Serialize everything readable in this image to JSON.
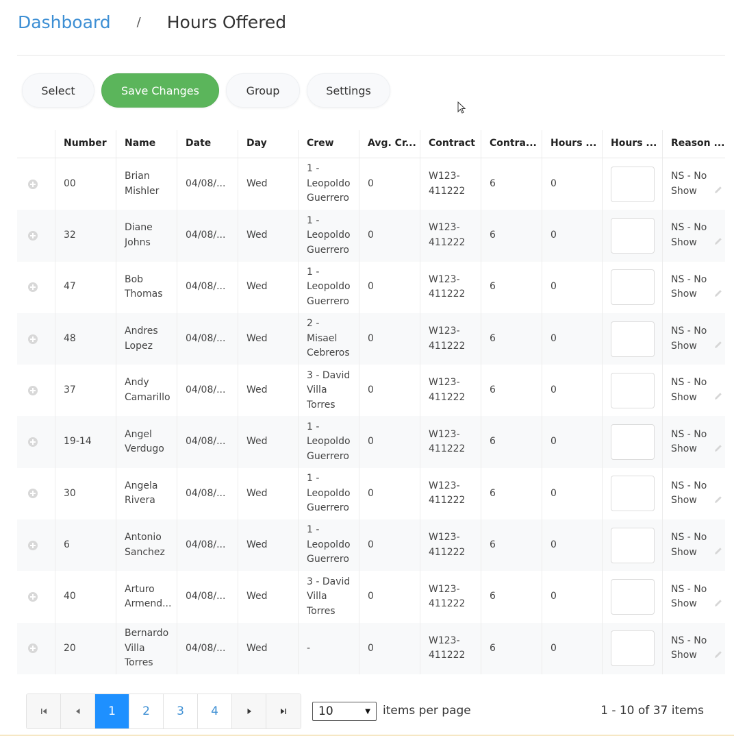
{
  "breadcrumb": {
    "root": "Dashboard",
    "separator": "/",
    "current": "Hours Offered"
  },
  "toolbar": {
    "select_label": "Select",
    "save_label": "Save Changes",
    "group_label": "Group",
    "settings_label": "Settings"
  },
  "colors": {
    "accent": "#3d8fd4",
    "save": "#5bb55b",
    "active_page": "#1e90ff"
  },
  "grid": {
    "columns": [
      "Number",
      "Name",
      "Date",
      "Day",
      "Crew",
      "Avg. Cr...",
      "Contract",
      "Contra...",
      "Hours ...",
      "Hours ...",
      "Reason ..."
    ],
    "rows": [
      {
        "number": "00",
        "name": "Brian Mishler",
        "date": "04/08/...",
        "day": "Wed",
        "crew": "1 - Leopoldo Guerrero",
        "avg": "0",
        "contract": "W123-411222",
        "contra": "6",
        "hours": "0",
        "hours_offered": "",
        "reason": "NS - No Show"
      },
      {
        "number": "32",
        "name": "Diane Johns",
        "date": "04/08/...",
        "day": "Wed",
        "crew": "1 - Leopoldo Guerrero",
        "avg": "0",
        "contract": "W123-411222",
        "contra": "6",
        "hours": "0",
        "hours_offered": "",
        "reason": "NS - No Show"
      },
      {
        "number": "47",
        "name": "Bob Thomas",
        "date": "04/08/...",
        "day": "Wed",
        "crew": "1 - Leopoldo Guerrero",
        "avg": "0",
        "contract": "W123-411222",
        "contra": "6",
        "hours": "0",
        "hours_offered": "",
        "reason": "NS - No Show"
      },
      {
        "number": "48",
        "name": "Andres Lopez",
        "date": "04/08/...",
        "day": "Wed",
        "crew": "2 - Misael Cebreros",
        "avg": "0",
        "contract": "W123-411222",
        "contra": "6",
        "hours": "0",
        "hours_offered": "",
        "reason": "NS - No Show"
      },
      {
        "number": "37",
        "name": "Andy Camarillo",
        "date": "04/08/...",
        "day": "Wed",
        "crew": "3 - David Villa Torres",
        "avg": "0",
        "contract": "W123-411222",
        "contra": "6",
        "hours": "0",
        "hours_offered": "",
        "reason": "NS - No Show"
      },
      {
        "number": "19-14",
        "name": "Angel Verdugo",
        "date": "04/08/...",
        "day": "Wed",
        "crew": "1 - Leopoldo Guerrero",
        "avg": "0",
        "contract": "W123-411222",
        "contra": "6",
        "hours": "0",
        "hours_offered": "",
        "reason": "NS - No Show"
      },
      {
        "number": "30",
        "name": "Angela Rivera",
        "date": "04/08/...",
        "day": "Wed",
        "crew": "1 - Leopoldo Guerrero",
        "avg": "0",
        "contract": "W123-411222",
        "contra": "6",
        "hours": "0",
        "hours_offered": "",
        "reason": "NS - No Show"
      },
      {
        "number": "6",
        "name": "Antonio Sanchez",
        "date": "04/08/...",
        "day": "Wed",
        "crew": "1 - Leopoldo Guerrero",
        "avg": "0",
        "contract": "W123-411222",
        "contra": "6",
        "hours": "0",
        "hours_offered": "",
        "reason": "NS - No Show"
      },
      {
        "number": "40",
        "name": "Arturo Armend...",
        "date": "04/08/...",
        "day": "Wed",
        "crew": "3 - David Villa Torres",
        "avg": "0",
        "contract": "W123-411222",
        "contra": "6",
        "hours": "0",
        "hours_offered": "",
        "reason": "NS - No Show"
      },
      {
        "number": "20",
        "name": "Bernardo Villa Torres",
        "date": "04/08/...",
        "day": "Wed",
        "crew": "-",
        "avg": "0",
        "contract": "W123-411222",
        "contra": "6",
        "hours": "0",
        "hours_offered": "",
        "reason": "NS - No Show"
      }
    ]
  },
  "pager": {
    "first_icon": "first-page-icon",
    "prev_icon": "prev-page-icon",
    "next_icon": "next-page-icon",
    "last_icon": "last-page-icon",
    "pages": [
      "1",
      "2",
      "3",
      "4"
    ],
    "current_page": "1",
    "per_page_value": "10",
    "per_page_label": "items per page",
    "info": "1 - 10 of 37 items"
  }
}
